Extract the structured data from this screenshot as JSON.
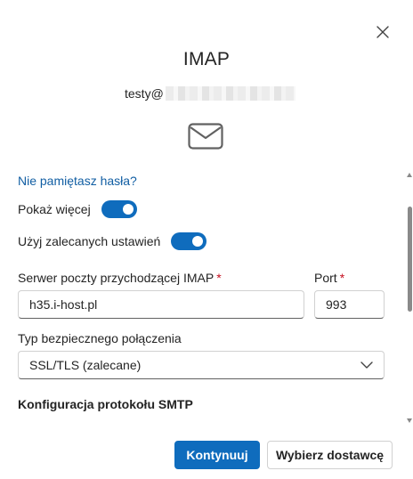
{
  "dialog": {
    "title": "IMAP",
    "email_prefix": "testy@"
  },
  "form": {
    "forgot_password_link": "Nie pamiętasz hasła?",
    "show_more_label": "Pokaż więcej",
    "show_more_on": true,
    "use_recommended_label": "Użyj zalecanych ustawień",
    "use_recommended_on": true,
    "imap_server_label": "Serwer poczty przychodzącej IMAP",
    "imap_server_required": "*",
    "imap_server_value": "h35.i-host.pl",
    "port_label": "Port",
    "port_required": "*",
    "port_value": "993",
    "security_type_label": "Typ bezpiecznego połączenia",
    "security_type_value": "SSL/TLS (zalecane)",
    "smtp_section_heading": "Konfiguracja protokołu SMTP"
  },
  "footer": {
    "continue_label": "Kontynuuj",
    "choose_provider_label": "Wybierz dostawcę"
  },
  "colors": {
    "accent": "#0f6cbd",
    "link": "#115ea3",
    "required": "#c50f1f"
  },
  "icons": {
    "close": "close-icon",
    "mail": "mail-envelope-icon",
    "chevron": "chevron-down-icon"
  }
}
